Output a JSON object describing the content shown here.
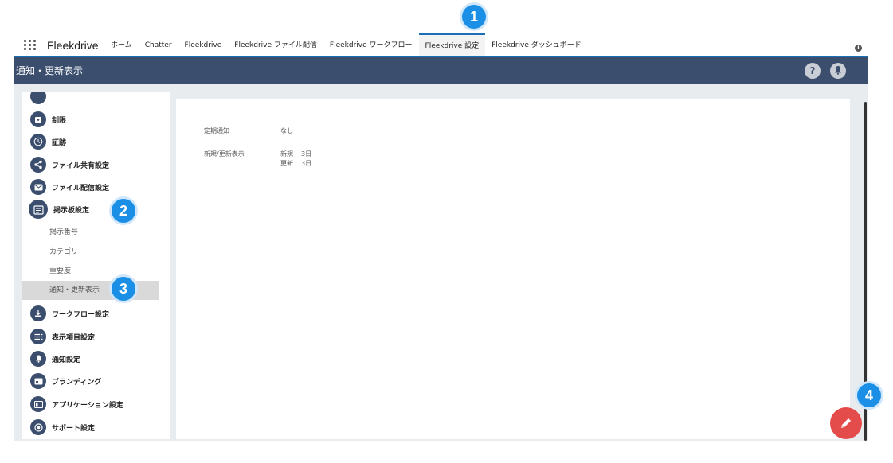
{
  "nav": {
    "app_name": "Fleekdrive",
    "tabs": [
      {
        "label": "ホーム"
      },
      {
        "label": "Chatter"
      },
      {
        "label": "Fleekdrive"
      },
      {
        "label": "Fleekdrive ファイル配信"
      },
      {
        "label": "Fleekdrive ワークフロー"
      },
      {
        "label": "Fleekdrive 設定",
        "active": true
      },
      {
        "label": "Fleekdrive ダッシュボード"
      }
    ],
    "info_icon": "i"
  },
  "header": {
    "title": "通知・更新表示",
    "help_label": "?",
    "notification_icon": "bell-icon"
  },
  "sidebar": {
    "items": [
      {
        "label": "制限",
        "icon": "lock-icon"
      },
      {
        "label": "証跡",
        "icon": "clock-icon"
      },
      {
        "label": "ファイル共有設定",
        "icon": "share-icon"
      },
      {
        "label": "ファイル配信設定",
        "icon": "mail-icon"
      },
      {
        "label": "掲示板設定",
        "icon": "board-icon"
      }
    ],
    "subitems": [
      {
        "label": "掲示番号"
      },
      {
        "label": "カテゴリー"
      },
      {
        "label": "重要度"
      },
      {
        "label": "通知・更新表示",
        "selected": true
      }
    ],
    "items_after": [
      {
        "label": "ワークフロー設定",
        "icon": "workflow-icon"
      },
      {
        "label": "表示項目設定",
        "icon": "list-icon"
      },
      {
        "label": "通知設定",
        "icon": "bell-icon"
      },
      {
        "label": "ブランディング",
        "icon": "branding-icon"
      },
      {
        "label": "アプリケーション設定",
        "icon": "app-icon"
      },
      {
        "label": "サポート設定",
        "icon": "support-icon"
      }
    ]
  },
  "main": {
    "periodic_notice_label": "定期通知",
    "periodic_notice_value": "なし",
    "new_update_label": "新規/更新表示",
    "new_label": "新規",
    "new_value": "3日",
    "update_label": "更新",
    "update_value": "3日"
  },
  "callouts": [
    "1",
    "2",
    "3",
    "4"
  ]
}
